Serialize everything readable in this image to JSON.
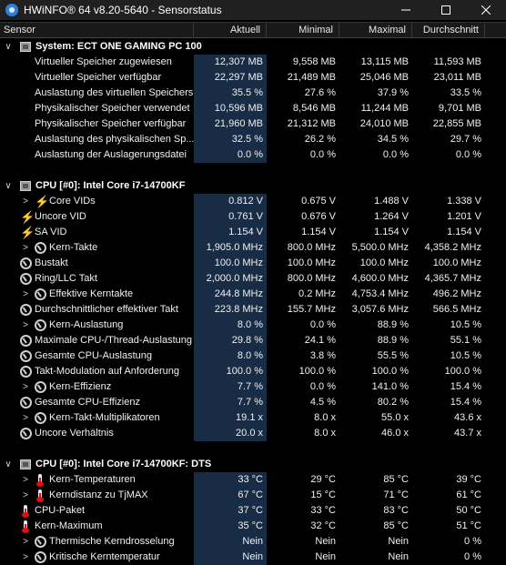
{
  "window": {
    "title": "HWiNFO® 64 v8.20-5640 - Sensorstatus",
    "minimize_icon": "minimize-icon",
    "maximize_icon": "maximize-icon",
    "close_icon": "close-icon"
  },
  "columns": {
    "sensor": "Sensor",
    "current": "Aktuell",
    "minimum": "Minimal",
    "maximum": "Maximal",
    "average": "Durchschnitt"
  },
  "groups": [
    {
      "title": "System: ECT ONE GAMING PC 100",
      "rows": [
        {
          "label": "Virtueller Speicher zugewiesen",
          "cur": "12,307 MB",
          "min": "9,558 MB",
          "max": "13,115 MB",
          "avg": "11,593 MB",
          "icon": "none",
          "chev": false
        },
        {
          "label": "Virtueller Speicher verfügbar",
          "cur": "22,297 MB",
          "min": "21,489 MB",
          "max": "25,046 MB",
          "avg": "23,011 MB",
          "icon": "none",
          "chev": false
        },
        {
          "label": "Auslastung des virtuellen Speichers",
          "cur": "35.5 %",
          "min": "27.6 %",
          "max": "37.9 %",
          "avg": "33.5 %",
          "icon": "none",
          "chev": false
        },
        {
          "label": "Physikalischer Speicher verwendet",
          "cur": "10,596 MB",
          "min": "8,546 MB",
          "max": "11,244 MB",
          "avg": "9,701 MB",
          "icon": "none",
          "chev": false
        },
        {
          "label": "Physikalischer Speicher verfügbar",
          "cur": "21,960 MB",
          "min": "21,312 MB",
          "max": "24,010 MB",
          "avg": "22,855 MB",
          "icon": "none",
          "chev": false
        },
        {
          "label": "Auslastung des physikalischen Sp...",
          "cur": "32.5 %",
          "min": "26.2 %",
          "max": "34.5 %",
          "avg": "29.7 %",
          "icon": "none",
          "chev": false
        },
        {
          "label": "Auslastung der Auslagerungsdatei",
          "cur": "0.0 %",
          "min": "0.0 %",
          "max": "0.0 %",
          "avg": "0.0 %",
          "icon": "none",
          "chev": false
        }
      ]
    },
    {
      "title": "CPU [#0]: Intel Core i7-14700KF",
      "rows": [
        {
          "label": "Core VIDs",
          "cur": "0.812 V",
          "min": "0.675 V",
          "max": "1.488 V",
          "avg": "1.338 V",
          "icon": "bolt",
          "chev": true
        },
        {
          "label": "Uncore VID",
          "cur": "0.761 V",
          "min": "0.676 V",
          "max": "1.264 V",
          "avg": "1.201 V",
          "icon": "bolt",
          "chev": false
        },
        {
          "label": "SA VID",
          "cur": "1.154 V",
          "min": "1.154 V",
          "max": "1.154 V",
          "avg": "1.154 V",
          "icon": "bolt",
          "chev": false
        },
        {
          "label": "Kern-Takte",
          "cur": "1,905.0 MHz",
          "min": "800.0 MHz",
          "max": "5,500.0 MHz",
          "avg": "4,358.2 MHz",
          "icon": "gauge",
          "chev": true
        },
        {
          "label": "Bustakt",
          "cur": "100.0 MHz",
          "min": "100.0 MHz",
          "max": "100.0 MHz",
          "avg": "100.0 MHz",
          "icon": "gauge",
          "chev": false
        },
        {
          "label": "Ring/LLC Takt",
          "cur": "2,000.0 MHz",
          "min": "800.0 MHz",
          "max": "4,600.0 MHz",
          "avg": "4,365.7 MHz",
          "icon": "gauge",
          "chev": false
        },
        {
          "label": "Effektive Kerntakte",
          "cur": "244.8 MHz",
          "min": "0.2 MHz",
          "max": "4,753.4 MHz",
          "avg": "496.2 MHz",
          "icon": "gauge",
          "chev": true
        },
        {
          "label": "Durchschnittlicher effektiver Takt",
          "cur": "223.8 MHz",
          "min": "155.7 MHz",
          "max": "3,057.6 MHz",
          "avg": "566.5 MHz",
          "icon": "gauge",
          "chev": false
        },
        {
          "label": "Kern-Auslastung",
          "cur": "8.0 %",
          "min": "0.0 %",
          "max": "88.9 %",
          "avg": "10.5 %",
          "icon": "gauge",
          "chev": true
        },
        {
          "label": "Maximale CPU-/Thread-Auslastung",
          "cur": "29.8 %",
          "min": "24.1 %",
          "max": "88.9 %",
          "avg": "55.1 %",
          "icon": "gauge",
          "chev": false
        },
        {
          "label": "Gesamte CPU-Auslastung",
          "cur": "8.0 %",
          "min": "3.8 %",
          "max": "55.5 %",
          "avg": "10.5 %",
          "icon": "gauge",
          "chev": false
        },
        {
          "label": "Takt-Modulation auf Anforderung",
          "cur": "100.0 %",
          "min": "100.0 %",
          "max": "100.0 %",
          "avg": "100.0 %",
          "icon": "gauge",
          "chev": false
        },
        {
          "label": "Kern-Effizienz",
          "cur": "7.7 %",
          "min": "0.0 %",
          "max": "141.0 %",
          "avg": "15.4 %",
          "icon": "gauge",
          "chev": true
        },
        {
          "label": "Gesamte CPU-Effizienz",
          "cur": "7.7 %",
          "min": "4.5 %",
          "max": "80.2 %",
          "avg": "15.4 %",
          "icon": "gauge",
          "chev": false
        },
        {
          "label": "Kern-Takt-Multiplikatoren",
          "cur": "19.1 x",
          "min": "8.0 x",
          "max": "55.0 x",
          "avg": "43.6 x",
          "icon": "gauge",
          "chev": true
        },
        {
          "label": "Uncore Verhältnis",
          "cur": "20.0 x",
          "min": "8.0 x",
          "max": "46.0 x",
          "avg": "43.7 x",
          "icon": "gauge",
          "chev": false
        }
      ]
    },
    {
      "title": "CPU [#0]: Intel Core i7-14700KF: DTS",
      "rows": [
        {
          "label": "Kern-Temperaturen",
          "cur": "33 °C",
          "min": "29 °C",
          "max": "85 °C",
          "avg": "39 °C",
          "icon": "therm",
          "chev": true
        },
        {
          "label": "Kerndistanz zu TjMAX",
          "cur": "67 °C",
          "min": "15 °C",
          "max": "71 °C",
          "avg": "61 °C",
          "icon": "therm",
          "chev": true
        },
        {
          "label": "CPU-Paket",
          "cur": "37 °C",
          "min": "33 °C",
          "max": "83 °C",
          "avg": "50 °C",
          "icon": "therm",
          "chev": false
        },
        {
          "label": "Kern-Maximum",
          "cur": "35 °C",
          "min": "32 °C",
          "max": "85 °C",
          "avg": "51 °C",
          "icon": "therm",
          "chev": false
        },
        {
          "label": "Thermische Kerndrosselung",
          "cur": "Nein",
          "min": "Nein",
          "max": "Nein",
          "avg": "0 %",
          "icon": "gauge",
          "chev": true
        },
        {
          "label": "Kritische Kerntemperatur",
          "cur": "Nein",
          "min": "Nein",
          "max": "Nein",
          "avg": "0 %",
          "icon": "gauge",
          "chev": true
        }
      ]
    }
  ]
}
